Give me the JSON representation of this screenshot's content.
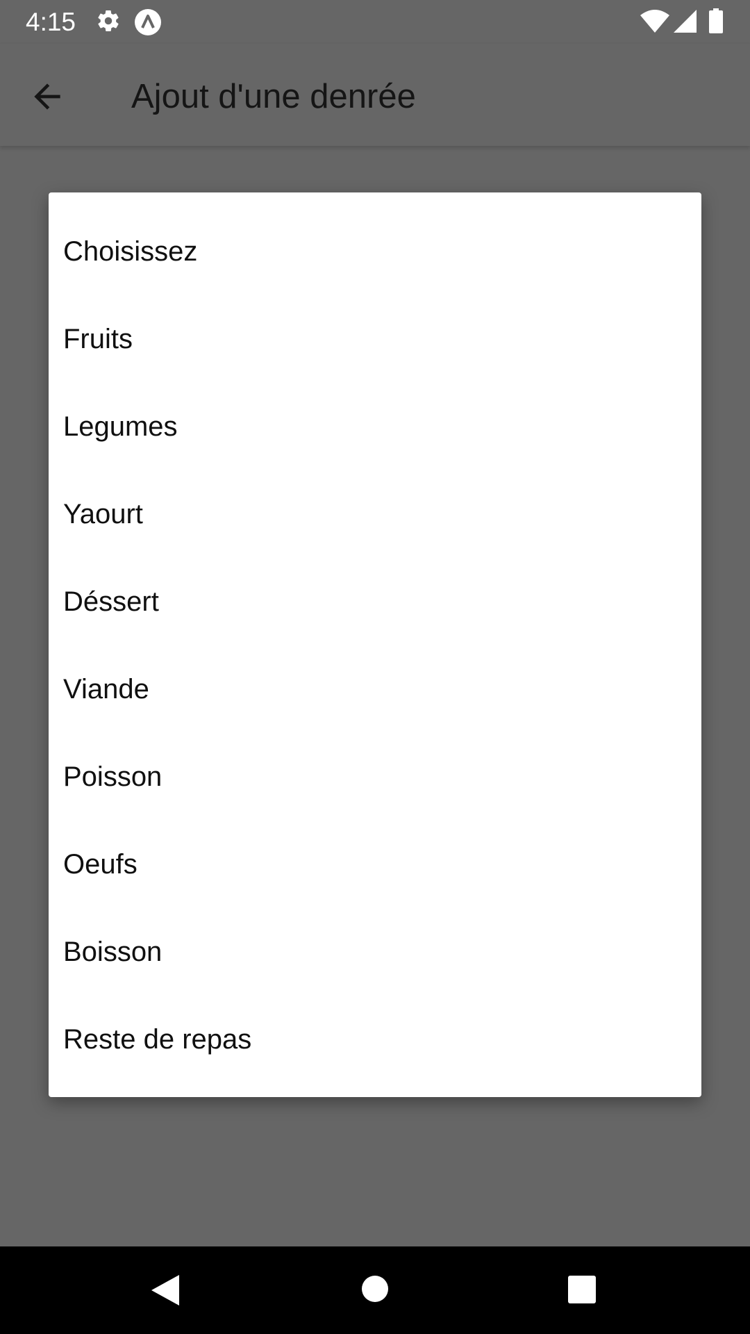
{
  "status_bar": {
    "time": "4:15",
    "icons": [
      "gear-icon",
      "app-a-icon",
      "wifi-icon",
      "signal-icon",
      "battery-icon"
    ]
  },
  "app_bar": {
    "title": "Ajout d'une denrée",
    "back_icon": "arrow-back-icon"
  },
  "dialog": {
    "options": [
      "Choisissez",
      "Fruits",
      "Legumes",
      "Yaourt",
      "Déssert",
      "Viande",
      "Poisson",
      "Oeufs",
      "Boisson",
      "Reste de repas"
    ]
  },
  "nav_bar": {
    "icons": [
      "nav-back-icon",
      "nav-home-icon",
      "nav-recents-icon"
    ]
  },
  "colors": {
    "scrim_background": "#666666",
    "dialog_background": "#ffffff",
    "nav_background": "#000000",
    "text_dark": "#101010"
  }
}
